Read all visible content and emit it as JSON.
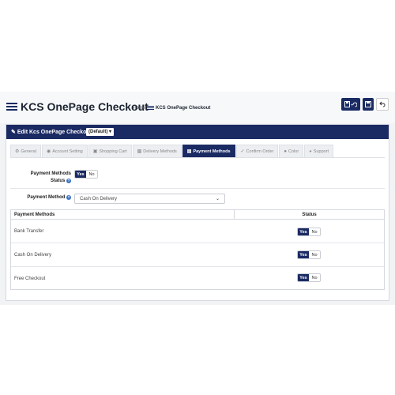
{
  "header": {
    "title": "KCS OnePage Checkout",
    "breadcrumb": {
      "home": "Home",
      "current": "KCS OnePage Checkout"
    },
    "buttons": {
      "save_stay_icon": "save-refresh-icon",
      "save_icon": "save-icon",
      "back_icon": "back-arrow-icon"
    }
  },
  "panel": {
    "title": "Edit Kcs OnePage Checkout",
    "store_select": "(Default)"
  },
  "tabs": [
    {
      "label": "General",
      "icon": "cog-icon",
      "active": false
    },
    {
      "label": "Account Setting",
      "icon": "eye-icon",
      "active": false
    },
    {
      "label": "Shopping Cart",
      "icon": "cart-icon",
      "active": false
    },
    {
      "label": "Delivery Methods",
      "icon": "truck-icon",
      "active": false
    },
    {
      "label": "Payment Methods",
      "icon": "card-icon",
      "active": true
    },
    {
      "label": "Confirm Order",
      "icon": "check-icon",
      "active": false
    },
    {
      "label": "Color",
      "icon": "palette-icon",
      "active": false
    },
    {
      "label": "Support",
      "icon": "support-icon",
      "active": false
    }
  ],
  "form": {
    "status_label_line1": "Payment Methods",
    "status_label_line2": "Status",
    "status_value": "Yes",
    "method_label": "Payment Method",
    "method_value": "Cash On Delivery"
  },
  "toggle": {
    "yes": "Yes",
    "no": "No"
  },
  "table": {
    "headers": [
      "Payment Methods",
      "Status"
    ],
    "rows": [
      {
        "name": "Bank Transfer",
        "status": "Yes"
      },
      {
        "name": "Cash On Delivery",
        "status": "Yes"
      },
      {
        "name": "Free Checkout",
        "status": "Yes"
      }
    ]
  },
  "colors": {
    "primary": "#1a2a63",
    "background": "#f2f3f5"
  }
}
